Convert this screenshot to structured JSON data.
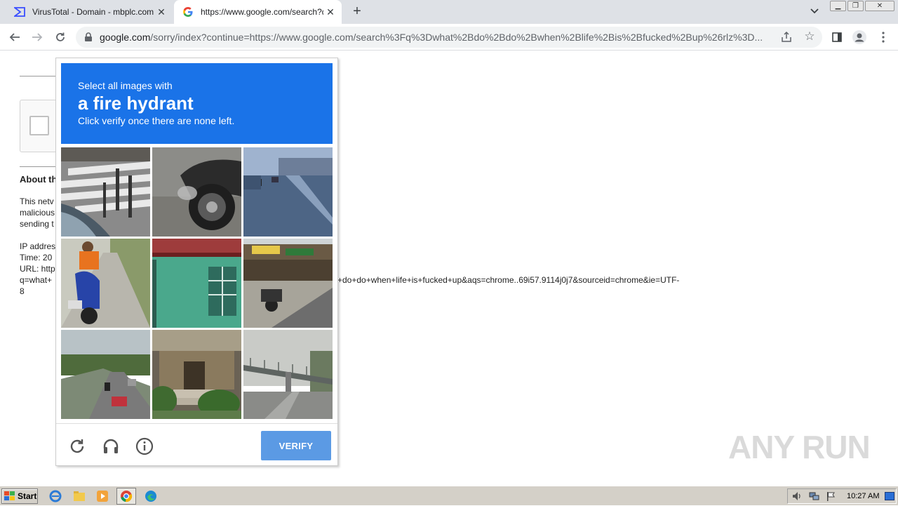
{
  "tabs": [
    {
      "title": "VirusTotal - Domain - mbplc.com",
      "active": false
    },
    {
      "title": "https://www.google.com/search?q=",
      "active": true
    }
  ],
  "address": {
    "host": "google.com",
    "path": "/sorry/index?continue=https://www.google.com/search%3Fq%3Dwhat%2Bdo%2Bdo%2Bwhen%2Blife%2Bis%2Bfucked%2Bup%26rlz%3D..."
  },
  "page": {
    "about_heading": "About th",
    "para1": [
      "This netv",
      "malicious",
      "sending t"
    ],
    "para2": [
      "IP addres",
      "Time: 20",
      "URL: http",
      "q=what+"
    ],
    "url_tail": "+do+do+when+life+is+fucked+up&aqs=chrome..69i57.9114j0j7&sourceid=chrome&ie=UTF-",
    "url_tail_2": "8"
  },
  "captcha": {
    "line1": "Select all images with",
    "target": "a fire hydrant",
    "line3": "Click verify once there are none left.",
    "verify_label": "VERIFY",
    "tiles": [
      "crosswalk-with-bollards",
      "motorcycle-wheel",
      "road-with-motorbikes",
      "person-on-scooter",
      "green-wall-window",
      "roadside-shops-motorbike",
      "highway-with-trees",
      "house-porch",
      "overpass-bridge"
    ]
  },
  "watermark": "ANY RUN",
  "taskbar": {
    "start_label": "Start",
    "clock": "10:27 AM"
  },
  "colors": {
    "captcha_header": "#1a73e8",
    "verify_button": "#4a90e2"
  }
}
